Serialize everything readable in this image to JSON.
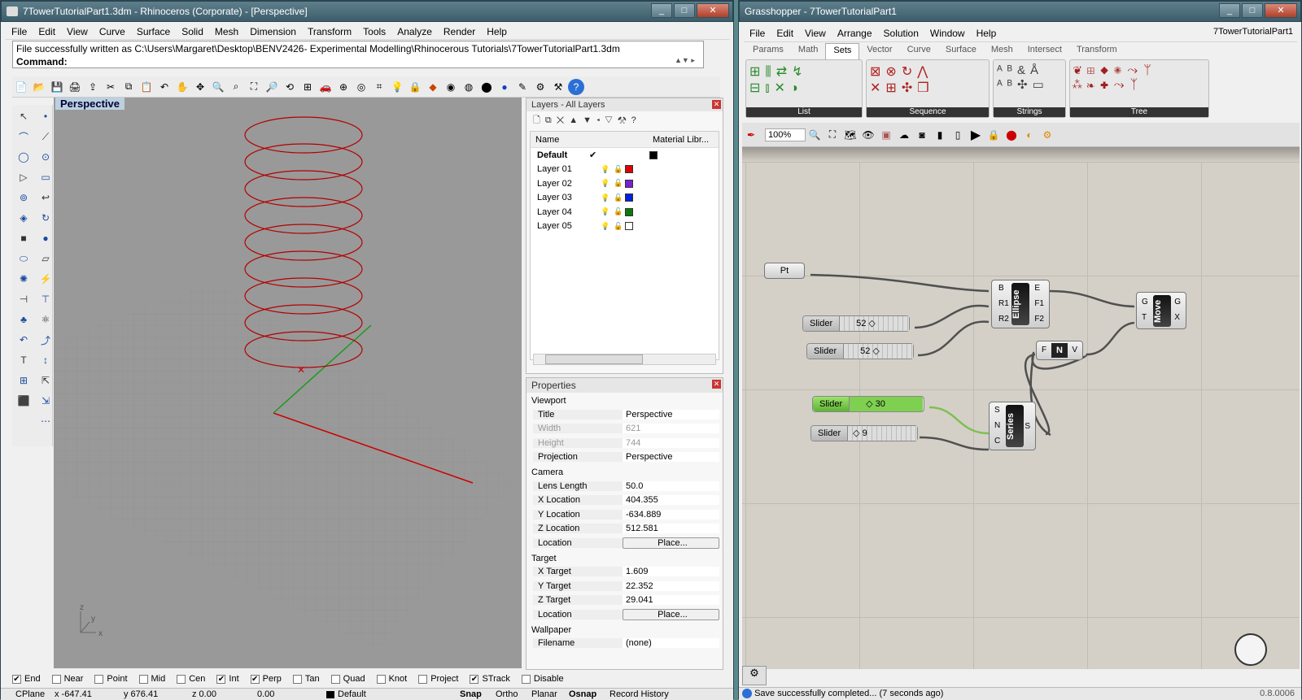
{
  "rhino": {
    "title": "7TowerTutorialPart1.3dm - Rhinoceros (Corporate) - [Perspective]",
    "menu": [
      "File",
      "Edit",
      "View",
      "Curve",
      "Surface",
      "Solid",
      "Mesh",
      "Dimension",
      "Transform",
      "Tools",
      "Analyze",
      "Render",
      "Help"
    ],
    "history": "File successfully written as C:\\Users\\Margaret\\Desktop\\BENV2426- Experimental Modelling\\Rhinocerous Tutorials\\7TowerTutorialPart1.3dm",
    "command_label": "Command:",
    "viewport_label": "Perspective",
    "layers": {
      "title": "Layers - All Layers",
      "col_name": "Name",
      "col_material": "Material Libr...",
      "items": [
        {
          "name": "Default",
          "color": "#000000",
          "current": "✔"
        },
        {
          "name": "Layer 01",
          "color": "#e00000",
          "current": ""
        },
        {
          "name": "Layer 02",
          "color": "#7a1fd6",
          "current": ""
        },
        {
          "name": "Layer 03",
          "color": "#0020e0",
          "current": ""
        },
        {
          "name": "Layer 04",
          "color": "#0a7a0a",
          "current": ""
        },
        {
          "name": "Layer 05",
          "color": "#ffffff",
          "current": ""
        }
      ]
    },
    "properties": {
      "title": "Properties",
      "viewport_section": "Viewport",
      "viewport": [
        [
          "Title",
          "Perspective"
        ],
        [
          "Width",
          "621"
        ],
        [
          "Height",
          "744"
        ],
        [
          "Projection",
          "Perspective"
        ]
      ],
      "camera_section": "Camera",
      "camera": [
        [
          "Lens Length",
          "50.0"
        ],
        [
          "X Location",
          "404.355"
        ],
        [
          "Y Location",
          "-634.889"
        ],
        [
          "Z Location",
          "512.581"
        ],
        [
          "Location",
          "Place..."
        ]
      ],
      "target_section": "Target",
      "target": [
        [
          "X Target",
          "1.609"
        ],
        [
          "Y Target",
          "22.352"
        ],
        [
          "Z Target",
          "29.041"
        ],
        [
          "Location",
          "Place..."
        ]
      ],
      "wallpaper_section": "Wallpaper",
      "wallpaper": [
        [
          "Filename",
          "(none)"
        ]
      ]
    },
    "osnaps": [
      {
        "label": "End",
        "on": true
      },
      {
        "label": "Near",
        "on": false
      },
      {
        "label": "Point",
        "on": false
      },
      {
        "label": "Mid",
        "on": false
      },
      {
        "label": "Cen",
        "on": false
      },
      {
        "label": "Int",
        "on": true
      },
      {
        "label": "Perp",
        "on": true
      },
      {
        "label": "Tan",
        "on": false
      },
      {
        "label": "Quad",
        "on": false
      },
      {
        "label": "Knot",
        "on": false
      },
      {
        "label": "Project",
        "on": false
      },
      {
        "label": "STrack",
        "on": true
      },
      {
        "label": "Disable",
        "on": false
      }
    ],
    "status": {
      "cplane": "CPlane",
      "x": "x -647.41",
      "y": "y 676.41",
      "z": "z 0.00",
      "w": "0.00",
      "layer": "Default",
      "snap": "Snap",
      "ortho": "Ortho",
      "planar": "Planar",
      "osnap": "Osnap",
      "record": "Record History"
    },
    "axis": {
      "z": "z",
      "y": "y",
      "x": "x"
    }
  },
  "gh": {
    "title": "Grasshopper - 7TowerTutorialPart1",
    "menu": [
      "File",
      "Edit",
      "View",
      "Arrange",
      "Solution",
      "Window",
      "Help"
    ],
    "doc_name": "7TowerTutorialPart1",
    "tabs": [
      "Params",
      "Math",
      "Sets",
      "Vector",
      "Curve",
      "Surface",
      "Mesh",
      "Intersect",
      "Transform"
    ],
    "active_tab": "Sets",
    "groups": [
      "List",
      "Sequence",
      "Strings",
      "Tree"
    ],
    "zoom": "100%",
    "components": {
      "pt": "Pt",
      "ellipse": {
        "name": "Ellipse",
        "in": [
          "B",
          "R1",
          "R2"
        ],
        "out": [
          "E",
          "F1",
          "F2"
        ]
      },
      "move": {
        "name": "Move",
        "in": [
          "G",
          "T"
        ],
        "out": [
          "G",
          "X"
        ]
      },
      "unit": {
        "name": "N",
        "in": "F",
        "out": "V"
      },
      "series": {
        "name": "Series",
        "in": [
          "S",
          "N",
          "C"
        ],
        "out": "S"
      }
    },
    "sliders": [
      {
        "label": "Slider",
        "value": "52"
      },
      {
        "label": "Slider",
        "value": "52"
      },
      {
        "label": "Slider",
        "value": "30"
      },
      {
        "label": "Slider",
        "value": "9"
      }
    ],
    "status": "Save successfully completed... (7 seconds ago)",
    "version": "0.8.0006"
  }
}
